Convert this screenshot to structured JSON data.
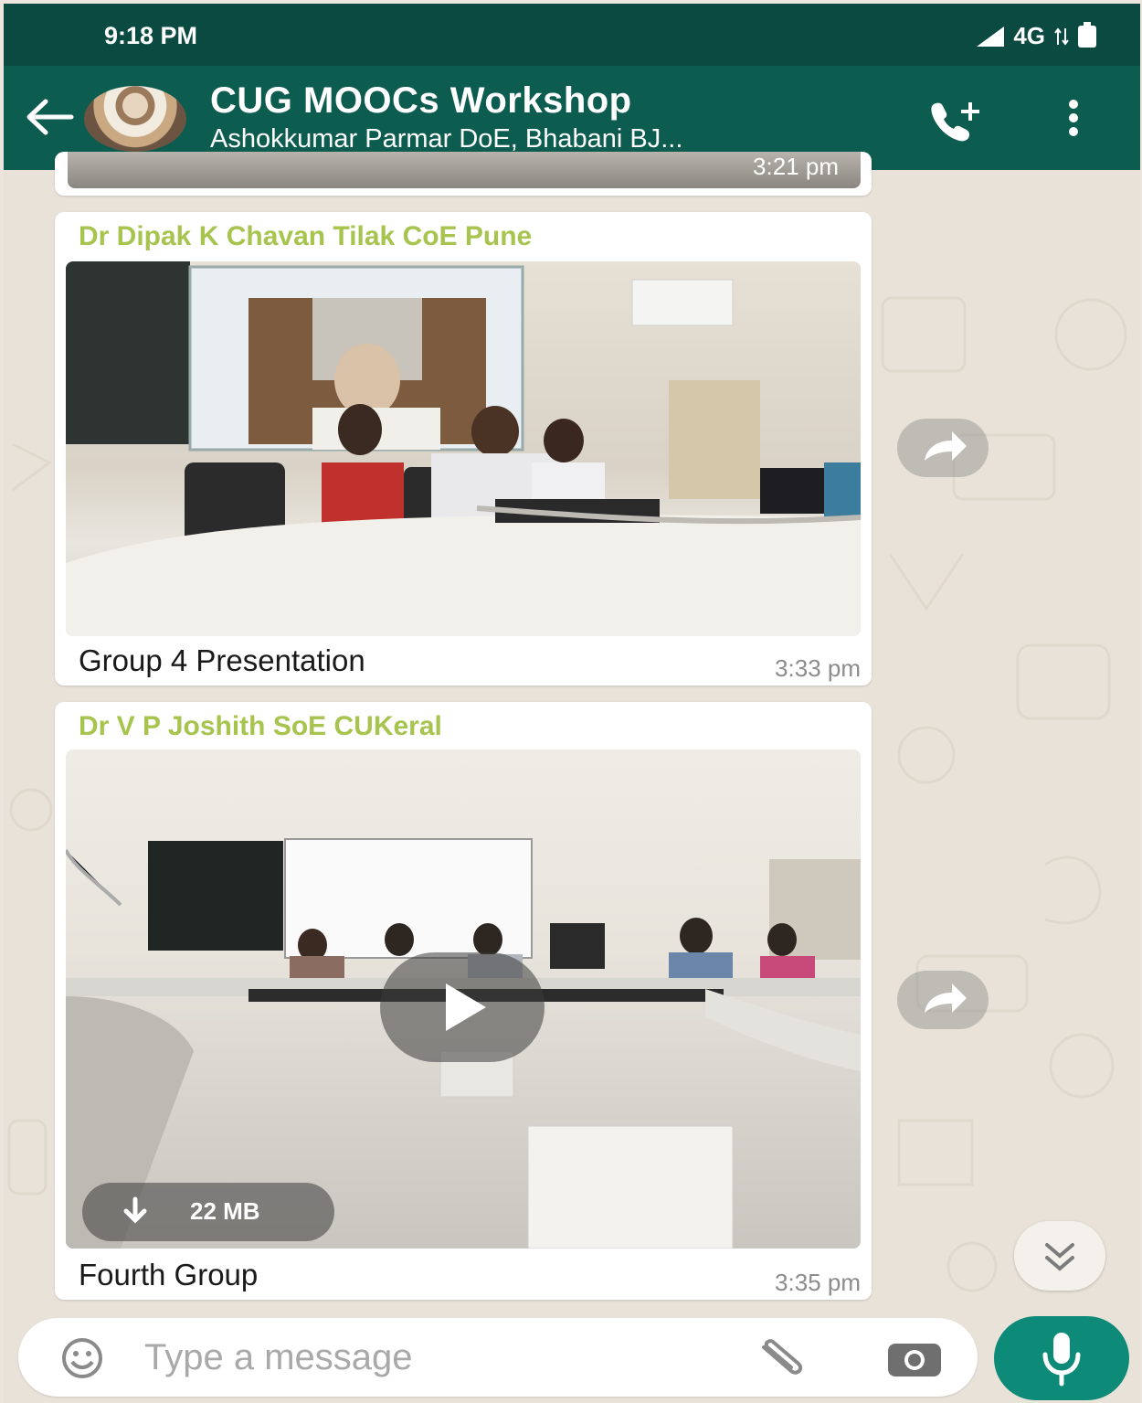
{
  "status_bar": {
    "time": "9:18 PM",
    "network": "4G"
  },
  "header": {
    "title": "CUG MOOCs Workshop",
    "subtitle": "Ashokkumar Parmar DoE, Bhabani BJ..."
  },
  "messages": [
    {
      "time": "3:21 pm"
    },
    {
      "sender": "Dr Dipak K Chavan Tilak CoE Pune",
      "caption": "Group 4 Presentation",
      "time": "3:33 pm"
    },
    {
      "sender": "Dr V P Joshith SoE CUKeral",
      "caption": "Fourth Group",
      "time": "3:35 pm",
      "video_size": "22 MB"
    }
  ],
  "composer": {
    "placeholder": "Type a message"
  },
  "colors": {
    "header": "#0d5c50",
    "status_bar": "#0a4a40",
    "sender_name": "#a7c44f",
    "mic_button": "#0d8a78"
  },
  "icons": [
    "back-arrow-icon",
    "add-call-icon",
    "more-menu-icon",
    "forward-icon",
    "play-icon",
    "download-icon",
    "scroll-down-icon",
    "emoji-icon",
    "attach-icon",
    "camera-icon",
    "mic-icon"
  ]
}
